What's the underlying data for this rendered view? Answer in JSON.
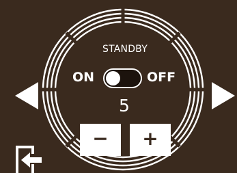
{
  "thermostat": {
    "status_label": "STANDBY",
    "on_label": "ON",
    "off_label": "OFF",
    "power_toggle_on": false,
    "level": "5",
    "decrease_label": "−",
    "increase_label": "+"
  },
  "icons": {
    "prev": "arrow-left-icon",
    "next": "arrow-right-icon",
    "exit": "exit-icon"
  },
  "colors": {
    "background": "#3a2a1e",
    "foreground": "#ffffff"
  }
}
